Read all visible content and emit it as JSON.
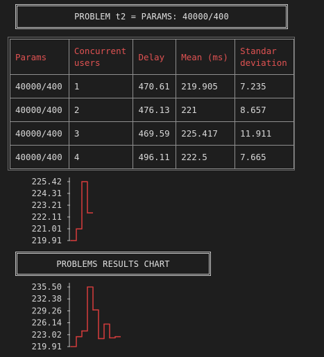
{
  "banner_top": {
    "title": "PROBLEM t2 = PARAMS: 40000/400"
  },
  "table": {
    "headers": [
      "Params",
      "Concurrent users",
      "Delay",
      "Mean (ms)",
      "Standar deviation"
    ],
    "header_lines": [
      [
        "Params"
      ],
      [
        "Concurrent",
        "users"
      ],
      [
        "Delay"
      ],
      [
        "Mean (ms)"
      ],
      [
        "Standar",
        "deviation"
      ]
    ],
    "rows": [
      [
        "40000/400",
        "1",
        "470.61",
        "219.905",
        "7.235"
      ],
      [
        "40000/400",
        "2",
        "476.13",
        "221",
        "8.657"
      ],
      [
        "40000/400",
        "3",
        "469.59",
        "225.417",
        "11.911"
      ],
      [
        "40000/400",
        "4",
        "496.11",
        "222.5",
        "7.665"
      ]
    ]
  },
  "banner_mid": {
    "title": "PROBLEMS RESULTS CHART"
  },
  "colors": {
    "accent": "#e05252",
    "line": "#cc3b3b",
    "border": "#c8c8c8",
    "background": "#1e1e1e"
  },
  "chart_data": [
    {
      "type": "line",
      "title": "",
      "xlabel": "",
      "ylabel": "",
      "y_ticks": [
        "225.42",
        "224.31",
        "223.21",
        "222.11",
        "221.01",
        "219.91"
      ],
      "ylim": [
        219.91,
        225.42
      ],
      "grid": false,
      "series": [
        {
          "values": [
            219.905,
            221,
            225.417,
            222.5
          ]
        }
      ]
    },
    {
      "type": "line",
      "title": "",
      "xlabel": "",
      "ylabel": "",
      "y_ticks": [
        "235.50",
        "232.38",
        "229.26",
        "226.14",
        "223.02",
        "219.91"
      ],
      "ylim": [
        219.91,
        235.5
      ],
      "grid": false,
      "series": [
        {
          "values": [
            219.91,
            222.5,
            224.0,
            235.5,
            229.5,
            222.0,
            225.8,
            222.2,
            222.5
          ]
        }
      ]
    }
  ]
}
